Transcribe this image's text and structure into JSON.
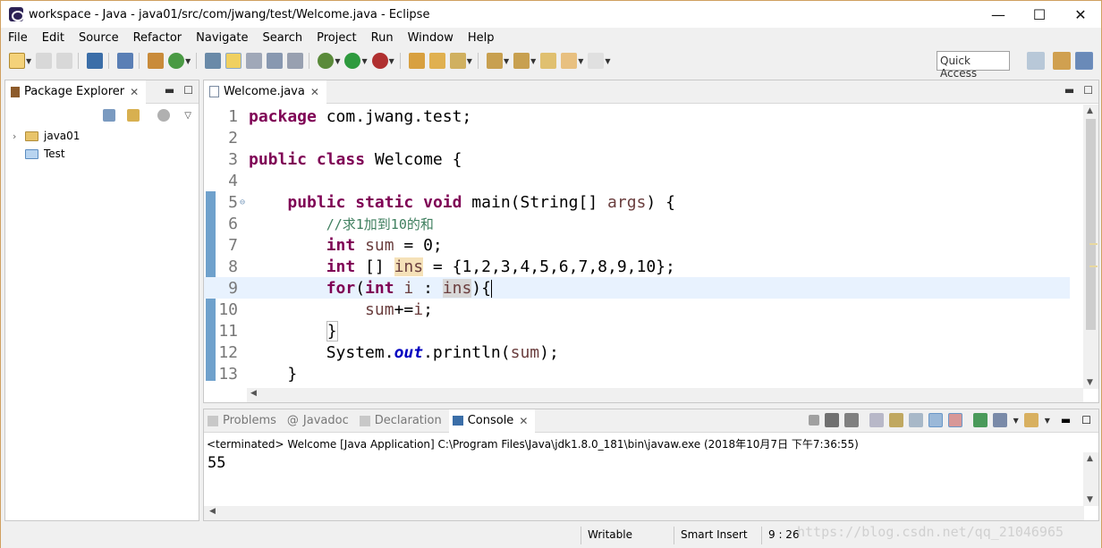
{
  "window": {
    "title": "workspace - Java - java01/src/com/jwang/test/Welcome.java - Eclipse",
    "minimize": "—",
    "maximize": "☐",
    "close": "✕"
  },
  "menu": [
    "File",
    "Edit",
    "Source",
    "Refactor",
    "Navigate",
    "Search",
    "Project",
    "Run",
    "Window",
    "Help"
  ],
  "toolbar": {
    "quick_access": "Quick Access"
  },
  "package_explorer": {
    "tab_label": "Package Explorer",
    "items": [
      {
        "label": "java01",
        "expandable": "›"
      },
      {
        "label": "Test"
      }
    ]
  },
  "editor": {
    "tab_label": "Welcome.java",
    "lines": [
      {
        "n": "1"
      },
      {
        "n": "2"
      },
      {
        "n": "3"
      },
      {
        "n": "4"
      },
      {
        "n": "5"
      },
      {
        "n": "6"
      },
      {
        "n": "7"
      },
      {
        "n": "8"
      },
      {
        "n": "9"
      },
      {
        "n": "10"
      },
      {
        "n": "11"
      },
      {
        "n": "12"
      },
      {
        "n": "13"
      }
    ],
    "code": {
      "l1_kw": "package",
      "l1_rest": " com.jwang.test;",
      "l3_kw1": "public",
      "l3_kw2": "class",
      "l3_rest": " Welcome {",
      "l5_kw1": "public",
      "l5_kw2": "static",
      "l5_kw3": "void",
      "l5_mid": " main(String[] ",
      "l5_var": "args",
      "l5_end": ") {",
      "l6_comment": "//求1加到10的和",
      "l7_kw": "int",
      "l7_var": "sum",
      "l7_rest": " = 0;",
      "l8_kw": "int",
      "l8_mid": " [] ",
      "l8_var": "ins",
      "l8_rest": " = {1,2,3,4,5,6,7,8,9,10};",
      "l9_kw1": "for",
      "l9_p": "(",
      "l9_kw2": "int",
      "l9_var1": "i",
      "l9_mid": " : ",
      "l9_var2": "ins",
      "l9_end": "){",
      "l10_var1": "sum",
      "l10_op": "+=",
      "l10_var2": "i",
      "l10_end": ";",
      "l11": "}",
      "l12_a": "System.",
      "l12_fld": "out",
      "l12_b": ".println(",
      "l12_var": "sum",
      "l12_c": ");",
      "l13": "}"
    }
  },
  "console": {
    "tabs": [
      "Problems",
      "Javadoc",
      "Declaration",
      "Console"
    ],
    "description": "<terminated> Welcome [Java Application] C:\\Program Files\\Java\\jdk1.8.0_181\\bin\\javaw.exe (2018年10月7日 下午7:36:55)",
    "output": "55"
  },
  "status": {
    "writable": "Writable",
    "insert_mode": "Smart Insert",
    "position": "9 : 26",
    "watermark": "https://blog.csdn.net/qq_21046965"
  },
  "colors": {
    "keyword": "#7f0055",
    "comment": "#3f7f5f",
    "variable": "#6a3e3e",
    "field": "#0000c0",
    "current_line": "#e8f2fe"
  }
}
